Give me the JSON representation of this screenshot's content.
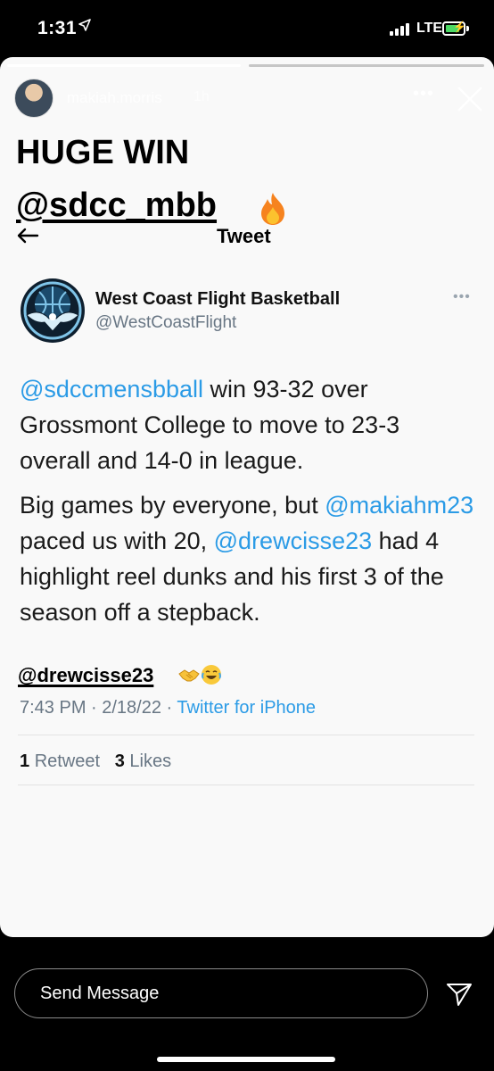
{
  "status_bar": {
    "time": "1:31",
    "network": "LTE"
  },
  "story": {
    "username": "makiah.morris",
    "time_ago": "1h",
    "headline": "HUGE WIN",
    "mention": "@sdcc_mbb",
    "drew_mention": "@drewcisse23"
  },
  "tweet": {
    "header_label": "Tweet",
    "account_name": "West Coast Flight Basketball",
    "account_handle": "@WestCoastFlight",
    "p1_mention": "@sdccmensbball",
    "p1_text": " win 93-32 over Grossmont College to move to 23-3 overall and 14-0 in league.",
    "p2_text_a": "Big games by everyone, but ",
    "p2_mention_a": "@makiahm23",
    "p2_text_b": " paced us with 20, ",
    "p2_mention_b": "@drewcisse23",
    "p2_text_c": " had 4 highlight reel dunks and his first 3 of the season off a stepback.",
    "timestamp": "7:43 PM · 2/18/22 · ",
    "source": "Twitter for iPhone",
    "retweet_count": "1",
    "retweet_label": "Retweet",
    "like_count": "3",
    "like_label": "Likes"
  },
  "message_bar": {
    "placeholder": "Send Message"
  },
  "colors": {
    "link": "#2b9be6",
    "muted": "#687684",
    "battery": "#4cd964"
  }
}
